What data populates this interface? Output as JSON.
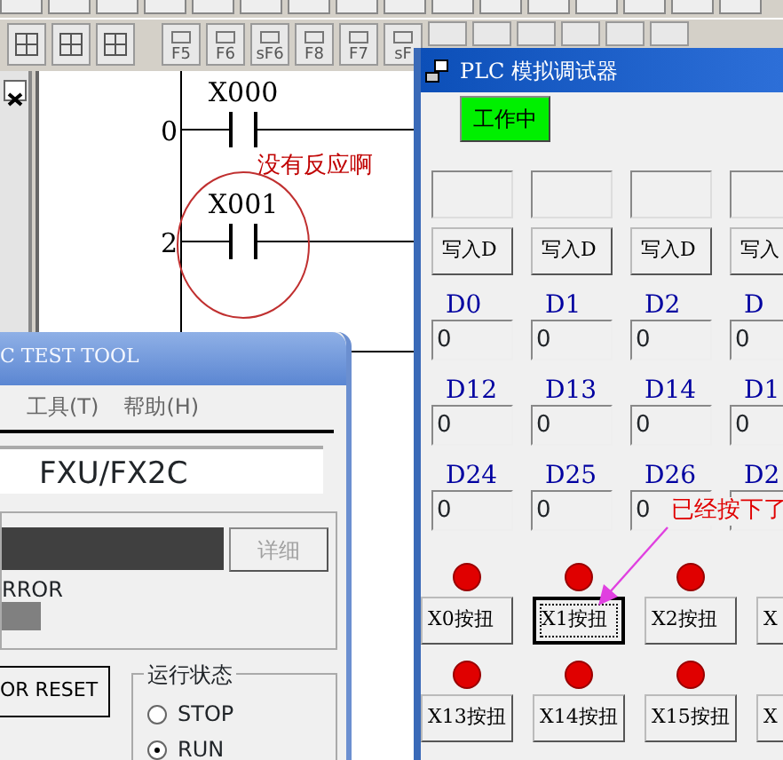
{
  "toolbar": {
    "buttons": [
      {
        "kind": "icon"
      },
      {
        "kind": "icon"
      },
      {
        "kind": "icon"
      },
      {
        "kind": "key",
        "label": "F5"
      },
      {
        "kind": "key",
        "label": "F6"
      },
      {
        "kind": "key",
        "label": "sF6"
      },
      {
        "kind": "key",
        "label": "F8"
      },
      {
        "kind": "key",
        "label": "F7"
      },
      {
        "kind": "key",
        "label": "sF"
      }
    ]
  },
  "ladder": {
    "rungs": [
      {
        "step": "0",
        "contact": "X000"
      },
      {
        "step": "2",
        "contact": "X001"
      }
    ],
    "annotation": "没有反应啊"
  },
  "test_tool": {
    "title": "C TEST TOOL",
    "menu": [
      "工具(T)",
      "帮助(H)"
    ],
    "model": "FXU/FX2C",
    "detail_button": {
      "label": "详细",
      "disabled": true
    },
    "error_label": "RROR",
    "reset_button": "OR RESET",
    "run_state": {
      "title": "运行状态",
      "options": [
        {
          "label": "STOP",
          "selected": false
        },
        {
          "label": "RUN",
          "selected": true
        }
      ]
    }
  },
  "simulator": {
    "title": "PLC 模拟调试器",
    "status_button": "工作中",
    "write_buttons": [
      "写入D",
      "写入D",
      "写入D",
      "写入"
    ],
    "registers": [
      {
        "name": "D0",
        "value": "0"
      },
      {
        "name": "D1",
        "value": "0"
      },
      {
        "name": "D2",
        "value": "0"
      },
      {
        "name": "D",
        "value": "0"
      },
      {
        "name": "D12",
        "value": "0"
      },
      {
        "name": "D13",
        "value": "0"
      },
      {
        "name": "D14",
        "value": "0"
      },
      {
        "name": "D1",
        "value": "0"
      },
      {
        "name": "D24",
        "value": "0"
      },
      {
        "name": "D25",
        "value": "0"
      },
      {
        "name": "D26",
        "value": "0"
      },
      {
        "name": "D2"
      }
    ],
    "inputs": [
      {
        "label": "X0按扭",
        "focused": false
      },
      {
        "label": "X1按扭",
        "focused": true
      },
      {
        "label": "X2按扭",
        "focused": false
      },
      {
        "label": "X",
        "focused": false
      },
      {
        "label": "X13按扭",
        "focused": false
      },
      {
        "label": "X14按扭",
        "focused": false
      },
      {
        "label": "X15按扭",
        "focused": false
      },
      {
        "label": "X",
        "focused": false
      }
    ],
    "annotation": "已经按下了"
  }
}
